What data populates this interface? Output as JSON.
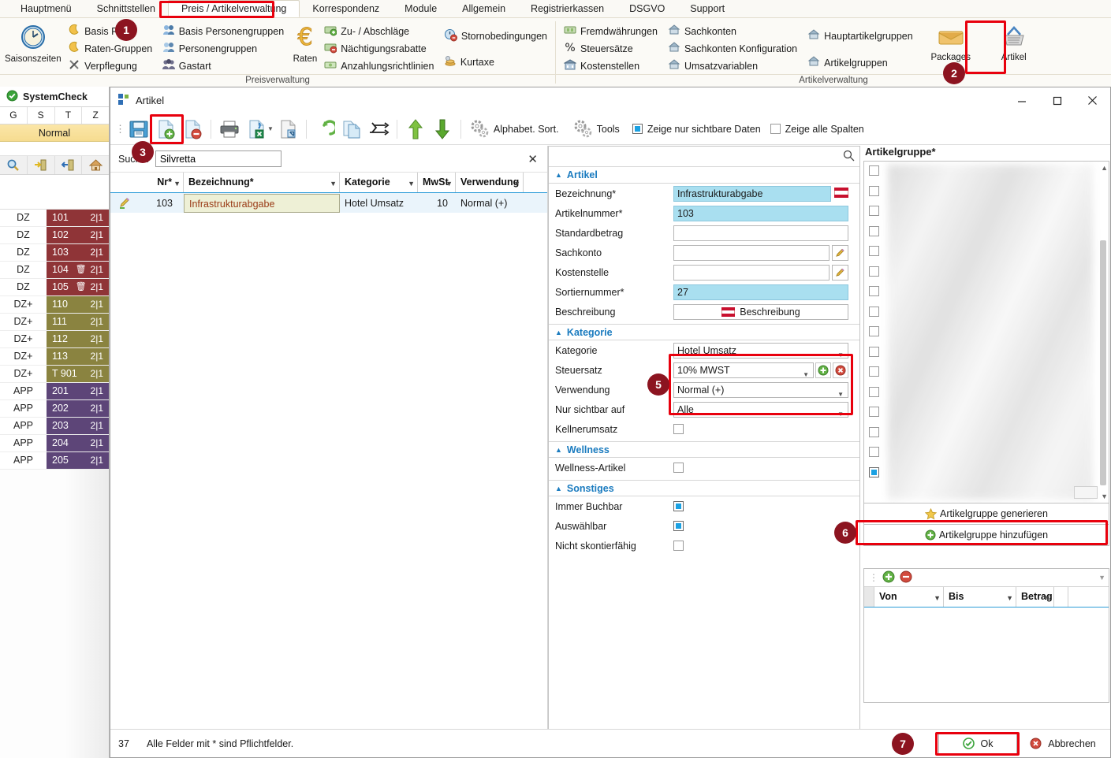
{
  "ribbon": {
    "tabs": [
      {
        "label": "Hauptmenü",
        "active": false
      },
      {
        "label": "Schnittstellen",
        "active": false
      },
      {
        "label": "Preis / Artikelverwaltung",
        "active": true
      },
      {
        "label": "Korrespondenz",
        "active": false
      },
      {
        "label": "Module",
        "active": false
      },
      {
        "label": "Allgemein",
        "active": false
      },
      {
        "label": "Registrierkassen",
        "active": false
      },
      {
        "label": "DSGVO",
        "active": false
      },
      {
        "label": "Support",
        "active": false
      }
    ],
    "groups": [
      {
        "title": "Preisverwaltung"
      },
      {
        "title": "Artikelverwaltung"
      }
    ],
    "big_saisonszeiten": "Saisonszeiten",
    "big_raten": "Raten",
    "big_packages": "Packages",
    "big_artikel": "Artikel",
    "items": {
      "basis_rate": "Basis Rate",
      "raten_gruppen": "Raten-Gruppen",
      "verpflegung": "Verpflegung",
      "basis_personengruppen": "Basis Personengruppen",
      "personengruppen": "Personengruppen",
      "gastart": "Gastart",
      "zu_abschlaege": "Zu- / Abschläge",
      "naechtigungsrabatte": "Nächtigungsrabatte",
      "anzahlungsrichtlinien": "Anzahlungsrichtlinien",
      "stornobedingungen": "Stornobedingungen",
      "kurtaxe": "Kurtaxe",
      "fremdwaehrungen": "Fremdwährungen",
      "steuersaetze": "Steuersätze",
      "kostenstellen": "Kostenstellen",
      "sachkonten": "Sachkonten",
      "sachkonten_konfiguration": "Sachkonten Konfiguration",
      "umsatzvariablen": "Umsatzvariablen",
      "hauptartikelgruppen": "Hauptartikelgruppen",
      "artikelgruppen": "Artikelgruppen"
    }
  },
  "sidebar": {
    "title": "SystemCheck",
    "columns": [
      "G",
      "S",
      "T",
      "Z"
    ],
    "status": "Normal",
    "tool_icons": [
      "search-icon",
      "check-in-icon",
      "check-out-icon",
      "home-icon"
    ],
    "rooms": [
      {
        "cat": "DZ",
        "num": "101",
        "tag": "2|1",
        "trash": false,
        "color": "c-dz"
      },
      {
        "cat": "DZ",
        "num": "102",
        "tag": "2|1",
        "trash": false,
        "color": "c-dz"
      },
      {
        "cat": "DZ",
        "num": "103",
        "tag": "2|1",
        "trash": false,
        "color": "c-dz"
      },
      {
        "cat": "DZ",
        "num": "104",
        "tag": "2|1",
        "trash": true,
        "color": "c-dz"
      },
      {
        "cat": "DZ",
        "num": "105",
        "tag": "2|1",
        "trash": true,
        "color": "c-dz"
      },
      {
        "cat": "DZ+",
        "num": "110",
        "tag": "2|1",
        "trash": false,
        "color": "c-dzp"
      },
      {
        "cat": "DZ+",
        "num": "111",
        "tag": "2|1",
        "trash": false,
        "color": "c-dzp"
      },
      {
        "cat": "DZ+",
        "num": "112",
        "tag": "2|1",
        "trash": false,
        "color": "c-dzp"
      },
      {
        "cat": "DZ+",
        "num": "113",
        "tag": "2|1",
        "trash": false,
        "color": "c-dzp"
      },
      {
        "cat": "DZ+",
        "num": "T 901",
        "tag": "2|1",
        "trash": false,
        "color": "c-dzp"
      },
      {
        "cat": "APP",
        "num": "201",
        "tag": "2|1",
        "trash": false,
        "color": "c-app"
      },
      {
        "cat": "APP",
        "num": "202",
        "tag": "2|1",
        "trash": false,
        "color": "c-app"
      },
      {
        "cat": "APP",
        "num": "203",
        "tag": "2|1",
        "trash": false,
        "color": "c-app"
      },
      {
        "cat": "APP",
        "num": "204",
        "tag": "2|1",
        "trash": false,
        "color": "c-app"
      },
      {
        "cat": "APP",
        "num": "205",
        "tag": "2|1",
        "trash": false,
        "color": "c-app"
      }
    ]
  },
  "window": {
    "title": "Artikel",
    "minimize": "—",
    "maximize": "▢",
    "close": "✕",
    "toolbar": {
      "alphabet_sort": "Alphabet. Sort.",
      "tools": "Tools",
      "show_visible_only": "Zeige nur sichtbare Daten",
      "show_visible_only_checked": true,
      "show_all_columns": "Zeige alle Spalten",
      "show_all_columns_checked": false,
      "buttons": [
        "save-icon",
        "new-record-icon",
        "delete-record-icon",
        "print-icon",
        "export-excel-icon",
        "import-icon",
        "undo-icon",
        "copy-icon",
        "transfer-icon",
        "move-up-icon",
        "move-down-icon"
      ]
    },
    "search": {
      "label": "Suche:",
      "value": "Silvretta",
      "placeholder": "",
      "clear": "✕"
    },
    "grid": {
      "columns": [
        "Nr*",
        "Bezeichnung*",
        "Kategorie",
        "MwSt",
        "Verwendung"
      ],
      "rows": [
        {
          "nr": "103",
          "bezeichnung": "Infrastrukturabgabe",
          "kategorie": "Hotel Umsatz",
          "mwst": "10",
          "verwendung": "Normal (+)"
        }
      ]
    }
  },
  "form": {
    "search_placeholder": "",
    "search_value": "",
    "sections": {
      "artikel": "Artikel",
      "kategorie": "Kategorie",
      "wellness": "Wellness",
      "sonstiges": "Sonstiges"
    },
    "fields": {
      "bezeichnung_label": "Bezeichnung*",
      "bezeichnung_value": "Infrastrukturabgabe",
      "artikelnummer_label": "Artikelnummer*",
      "artikelnummer_value": "103",
      "standardbetrag_label": "Standardbetrag",
      "standardbetrag_value": "",
      "sachkonto_label": "Sachkonto",
      "sachkonto_value": "",
      "kostenstelle_label": "Kostenstelle",
      "kostenstelle_value": "",
      "sortiernummer_label": "Sortiernummer*",
      "sortiernummer_value": "27",
      "beschreibung_label": "Beschreibung",
      "beschreibung_button": "Beschreibung",
      "kategorie_label": "Kategorie",
      "kategorie_value": "Hotel Umsatz",
      "steuersatz_label": "Steuersatz",
      "steuersatz_value": "10% MWST",
      "verwendung_label": "Verwendung",
      "verwendung_value": "Normal (+)",
      "nur_sichtbar_label": "Nur sichtbar auf",
      "nur_sichtbar_value": "Alle",
      "kellnerumsatz_label": "Kellnerumsatz",
      "kellnerumsatz_checked": false,
      "wellness_artikel_label": "Wellness-Artikel",
      "wellness_artikel_checked": false,
      "immer_buchbar_label": "Immer Buchbar",
      "immer_buchbar_checked": true,
      "auswaehlbar_label": "Auswählbar",
      "auswaehlbar_checked": true,
      "nicht_skontierfaehig_label": "Nicht skontierfähig",
      "nicht_skontierfaehig_checked": false
    }
  },
  "right_panel": {
    "title": "Artikelgruppe*",
    "generate_button": "Artikelgruppe generieren",
    "add_button": "Artikelgruppe hinzufügen",
    "mini_grid": {
      "columns": [
        "Von",
        "Bis",
        "Betrag"
      ],
      "rows": []
    }
  },
  "footer": {
    "count": "37",
    "message": "Alle Felder mit * sind Pflichtfelder.",
    "ok": "Ok",
    "cancel": "Abbrechen"
  },
  "annotations": {
    "badges": [
      "1",
      "2",
      "3",
      "5",
      "6",
      "7"
    ]
  },
  "colors": {
    "accent_red": "#e8000d",
    "badge_bg": "#8c1420",
    "required_field": "#a9dff0",
    "section_header": "#1a7bbf",
    "grid_row_selected": "#eaf4fb",
    "status_normal": "#f6dc90",
    "room_dz": "#8f3437",
    "room_dz_plus": "#8a8340",
    "room_app": "#5d4578"
  }
}
